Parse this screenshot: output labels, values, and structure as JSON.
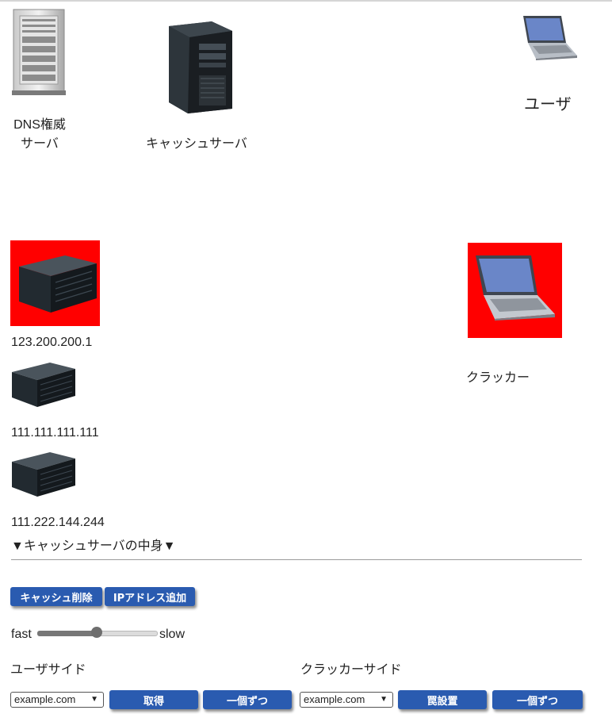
{
  "nodes": {
    "dns": {
      "line1": "DNS権威",
      "line2": "サーバ"
    },
    "cache": {
      "label": "キャッシュサーバ"
    },
    "user": {
      "label": "ユーザ"
    },
    "servers": [
      {
        "ip": "123.200.200.1"
      },
      {
        "ip": "111.111.111.111"
      },
      {
        "ip": "111.222.144.244"
      }
    ],
    "cracker": {
      "label": "クラッカー"
    }
  },
  "cache_contents_label": "▼キャッシュサーバの中身▼",
  "buttons": {
    "delete_cache": "キャッシュ削除",
    "add_ip": "IPアドレス追加",
    "fetch": "取得",
    "step_user": "一個ずつ",
    "set_trap": "罠設置",
    "step_cracker": "一個ずつ"
  },
  "speed": {
    "fast": "fast",
    "slow": "slow",
    "level": 0.5
  },
  "sides": {
    "user": "ユーザサイド",
    "cracker": "クラッカーサイド"
  },
  "selects": {
    "user_domain": "example.com",
    "cracker_domain": "example.com"
  },
  "colors": {
    "button": "#2a5bb0",
    "highlight": "#ff0000"
  }
}
